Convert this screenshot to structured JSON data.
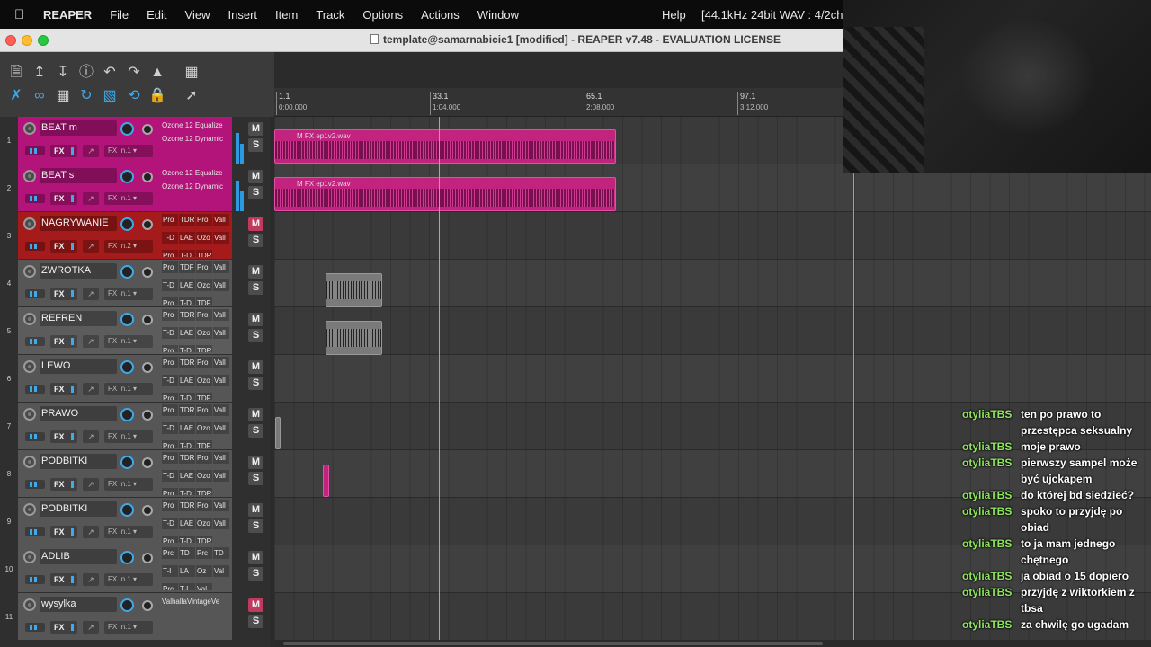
{
  "menubar": {
    "app": "REAPER",
    "items": [
      "File",
      "Edit",
      "View",
      "Insert",
      "Item",
      "Track",
      "Options",
      "Actions",
      "Window"
    ],
    "help": "Help",
    "status": "[44.1kHz 24bit WAV : 4/2ch 51"
  },
  "window": {
    "title": "template@samarnabicie1 [modified] - REAPER v7.48 - EVALUATION LICENSE"
  },
  "ruler": {
    "marks": [
      {
        "bar": "1.1",
        "time": "0:00.000"
      },
      {
        "bar": "33.1",
        "time": "1:04.000"
      },
      {
        "bar": "65.1",
        "time": "2:08.000"
      },
      {
        "bar": "97.1",
        "time": "3:12.000"
      }
    ]
  },
  "tracks": [
    {
      "num": "1",
      "name": "BEAT m",
      "color": "#b3147a",
      "fx_lines": [
        "Ozone 12 Equalize",
        "Ozone 12 Dynamic"
      ],
      "route": "In.1",
      "mute_active": false
    },
    {
      "num": "2",
      "name": "BEAT s",
      "color": "#b3147a",
      "fx_lines": [
        "Ozone 12 Equalize",
        "Ozone 12 Dynamic"
      ],
      "route": "In.1",
      "mute_active": false
    },
    {
      "num": "3",
      "name": "NAGRYWANIE",
      "color": "#a51a1a",
      "fx_grid": [
        [
          "Pro",
          "TDR",
          "Pro",
          "Vall"
        ],
        [
          "T-D",
          "LAE",
          "Ozo",
          "Vall"
        ],
        [
          "Pro",
          "T-D",
          "TDR"
        ]
      ],
      "route": "In.2",
      "mute_active": true
    },
    {
      "num": "4",
      "name": "ZWROTKA",
      "color": "#565656",
      "fx_grid": [
        [
          "Pro",
          "TDF",
          "Pro",
          "Vall"
        ],
        [
          "T-D",
          "LAE",
          "Ozc",
          "Vall"
        ],
        [
          "Pro",
          "T-D",
          "TDF"
        ]
      ],
      "route": "In.1",
      "mute_active": false
    },
    {
      "num": "5",
      "name": "REFREN",
      "color": "#5c5c5c",
      "fx_grid": [
        [
          "Pro",
          "TDR",
          "Pro",
          "Vall"
        ],
        [
          "T-D",
          "LAE",
          "Ozo",
          "Vall"
        ],
        [
          "Pro",
          "T-D",
          "TDR"
        ]
      ],
      "route": "In.1",
      "mute_active": false
    },
    {
      "num": "6",
      "name": "LEWO",
      "color": "#565656",
      "fx_grid": [
        [
          "Pro",
          "TDR",
          "Pro",
          "Vall"
        ],
        [
          "T-D",
          "LAE",
          "Ozo",
          "Vall"
        ],
        [
          "Pro",
          "T-D",
          "TDF"
        ]
      ],
      "route": "In.1",
      "mute_active": false
    },
    {
      "num": "7",
      "name": "PRAWO",
      "color": "#565656",
      "fx_grid": [
        [
          "Pro",
          "TDR",
          "Pro",
          "Vall"
        ],
        [
          "T-D",
          "LAE",
          "Ozo",
          "Vall"
        ],
        [
          "Pro",
          "T-D",
          "TDF"
        ]
      ],
      "route": "In.1",
      "mute_active": false
    },
    {
      "num": "8",
      "name": "PODBITKI",
      "color": "#565656",
      "fx_grid": [
        [
          "Pro",
          "TDR",
          "Pro",
          "Vall"
        ],
        [
          "T-D",
          "LAE",
          "Ozo",
          "Vall"
        ],
        [
          "Pro",
          "T-D",
          "TDR"
        ]
      ],
      "route": "In.1",
      "mute_active": false
    },
    {
      "num": "9",
      "name": "PODBITKI",
      "color": "#565656",
      "fx_grid": [
        [
          "Pro",
          "TDR",
          "Pro",
          "Vall"
        ],
        [
          "T-D",
          "LAE",
          "Ozo",
          "Vall"
        ],
        [
          "Pro",
          "T-D",
          "TDR"
        ]
      ],
      "route": "In.1",
      "mute_active": false
    },
    {
      "num": "10",
      "name": "ADLIB",
      "color": "#565656",
      "fx_grid": [
        [
          "Prc",
          "TD",
          "Prc",
          "TD"
        ],
        [
          "T-I",
          "LA",
          "Oz",
          "Val"
        ],
        [
          "Prc",
          "T-I",
          "Val"
        ]
      ],
      "route": "In.1",
      "mute_active": false
    },
    {
      "num": "11",
      "name": "wysylka",
      "color": "#565656",
      "fx_lines": [
        "ValhallaVintageVe"
      ],
      "route": "In.1",
      "mute_active": true
    }
  ],
  "items": {
    "beat_m_file": "ep1v2.wav",
    "beat_s_file": "ep1v2.wav",
    "header_tags": "M FX"
  },
  "buttons": {
    "mute": "M",
    "solo": "S",
    "fx": "FX"
  },
  "chat": [
    {
      "user": "otyliaTBS",
      "text": "ten po prawo to przestępca seksualny"
    },
    {
      "user": "otyliaTBS",
      "text": "moje prawo"
    },
    {
      "user": "otyliaTBS",
      "text": "pierwszy sampel może być ujckapem"
    },
    {
      "user": "otyliaTBS",
      "text": "do której bd siedzieć?"
    },
    {
      "user": "otyliaTBS",
      "text": "spoko to przyjdę po obiad"
    },
    {
      "user": "otyliaTBS",
      "text": "to ja mam jednego chętnego"
    },
    {
      "user": "otyliaTBS",
      "text": "ja obiad o 15 dopiero"
    },
    {
      "user": "otyliaTBS",
      "text": "przyjdę z wiktorkiem z tbsa"
    },
    {
      "user": "otyliaTBS",
      "text": "za chwilę go ugadam"
    }
  ],
  "icons": {
    "toolbar_row1": [
      "new-project-icon",
      "open-icon",
      "save-icon",
      "info-icon",
      "undo-icon",
      "redo-icon",
      "metronome-icon",
      "grid-icon"
    ],
    "toolbar_row2": [
      "envelope-icon",
      "link-icon",
      "snap-icon",
      "ripple-icon",
      "grid-lines-icon",
      "loop-icon",
      "lock-icon",
      "cursor-icon"
    ]
  }
}
